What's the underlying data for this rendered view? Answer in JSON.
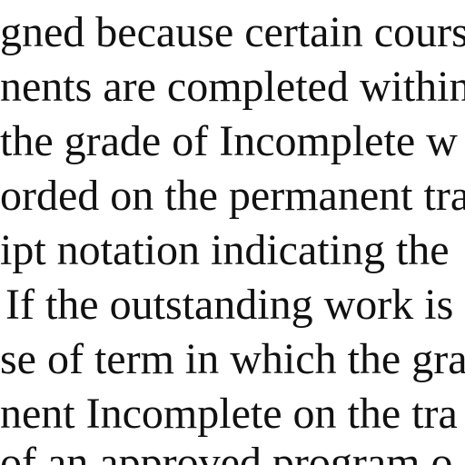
{
  "document": {
    "lines": [
      "gned because certain course",
      "nents are completed within",
      "the grade of Incomplete w",
      "orded on the permanent tra",
      "ipt notation indicating the",
      "If the outstanding work is",
      "se of term in which the gra",
      "nent Incomplete on the tra",
      "of an approved program o"
    ]
  }
}
